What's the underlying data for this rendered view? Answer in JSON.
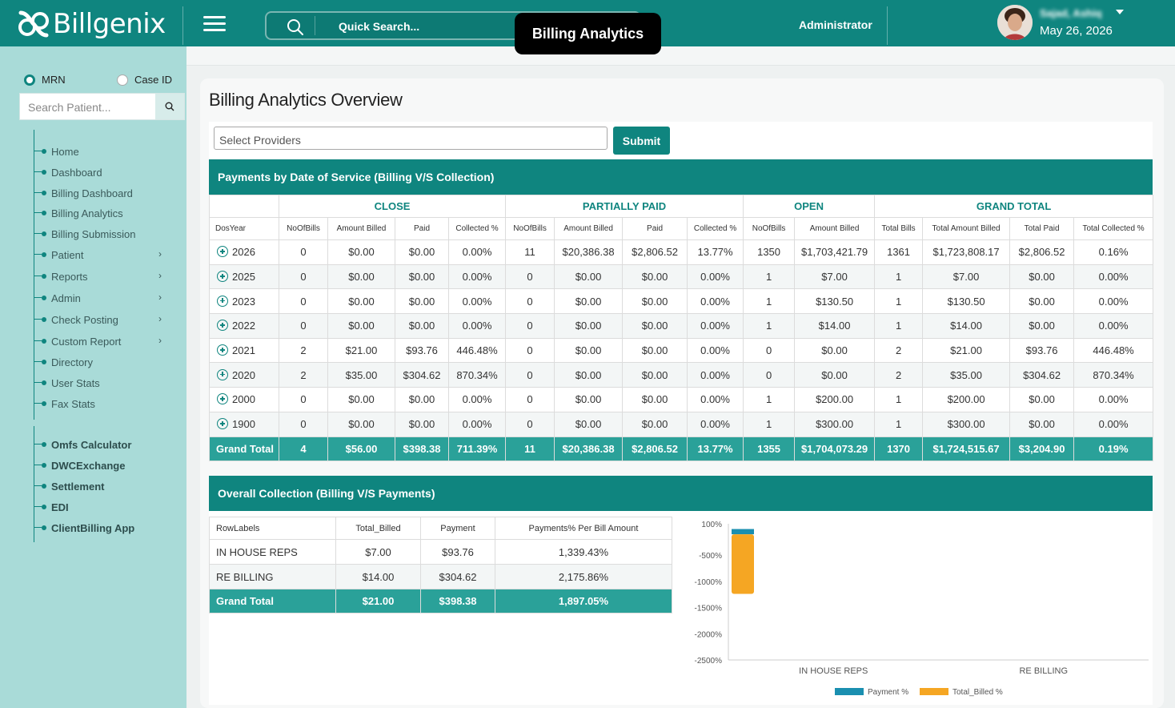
{
  "header": {
    "logo_text": "Billgenix",
    "search_placeholder": "Quick Search...",
    "tooltip": "Billing Analytics",
    "role": "Administrator",
    "username": "Sajad, Ashiq",
    "date": "May 26, 2026"
  },
  "sidebar": {
    "radio_mrn": "MRN",
    "radio_case": "Case ID",
    "search_placeholder": "Search Patient...",
    "items": [
      {
        "label": "Home"
      },
      {
        "label": "Dashboard"
      },
      {
        "label": "Billing Dashboard"
      },
      {
        "label": "Billing Analytics"
      },
      {
        "label": "Billing Submission"
      },
      {
        "label": "Patient"
      },
      {
        "label": "Reports"
      },
      {
        "label": "Admin"
      },
      {
        "label": "Check Posting"
      },
      {
        "label": "Custom Report"
      },
      {
        "label": "Directory"
      },
      {
        "label": "User Stats"
      },
      {
        "label": "Fax Stats"
      }
    ],
    "items2": [
      {
        "label": "Omfs Calculator"
      },
      {
        "label": "DWCExchange"
      },
      {
        "label": "Settlement"
      },
      {
        "label": "EDI"
      },
      {
        "label": "ClientBilling App"
      }
    ]
  },
  "main": {
    "title": "Billing Analytics Overview",
    "provider_placeholder": "Select Providers",
    "submit_label": "Submit",
    "section1_title": "Payments by Date of Service (Billing V/S Collection)",
    "section2_title": "Overall Collection (Billing V/S Payments)"
  },
  "payments_table": {
    "groups": [
      "CLOSE",
      "PARTIALLY PAID",
      "OPEN",
      "GRAND TOTAL"
    ],
    "columns": [
      "DosYear",
      "NoOfBills",
      "Amount Billed",
      "Paid",
      "Collected %",
      "NoOfBills",
      "Amount Billed",
      "Paid",
      "Collected %",
      "NoOfBills",
      "Amount Billed",
      "Total Bills",
      "Total Amount Billed",
      "Total Paid",
      "Total Collected %"
    ],
    "rows": [
      [
        "2026",
        "0",
        "$0.00",
        "$0.00",
        "0.00%",
        "11",
        "$20,386.38",
        "$2,806.52",
        "13.77%",
        "1350",
        "$1,703,421.79",
        "1361",
        "$1,723,808.17",
        "$2,806.52",
        "0.16%"
      ],
      [
        "2025",
        "0",
        "$0.00",
        "$0.00",
        "0.00%",
        "0",
        "$0.00",
        "$0.00",
        "0.00%",
        "1",
        "$7.00",
        "1",
        "$7.00",
        "$0.00",
        "0.00%"
      ],
      [
        "2023",
        "0",
        "$0.00",
        "$0.00",
        "0.00%",
        "0",
        "$0.00",
        "$0.00",
        "0.00%",
        "1",
        "$130.50",
        "1",
        "$130.50",
        "$0.00",
        "0.00%"
      ],
      [
        "2022",
        "0",
        "$0.00",
        "$0.00",
        "0.00%",
        "0",
        "$0.00",
        "$0.00",
        "0.00%",
        "1",
        "$14.00",
        "1",
        "$14.00",
        "$0.00",
        "0.00%"
      ],
      [
        "2021",
        "2",
        "$21.00",
        "$93.76",
        "446.48%",
        "0",
        "$0.00",
        "$0.00",
        "0.00%",
        "0",
        "$0.00",
        "2",
        "$21.00",
        "$93.76",
        "446.48%"
      ],
      [
        "2020",
        "2",
        "$35.00",
        "$304.62",
        "870.34%",
        "0",
        "$0.00",
        "$0.00",
        "0.00%",
        "0",
        "$0.00",
        "2",
        "$35.00",
        "$304.62",
        "870.34%"
      ],
      [
        "2000",
        "0",
        "$0.00",
        "$0.00",
        "0.00%",
        "0",
        "$0.00",
        "$0.00",
        "0.00%",
        "1",
        "$200.00",
        "1",
        "$200.00",
        "$0.00",
        "0.00%"
      ],
      [
        "1900",
        "0",
        "$0.00",
        "$0.00",
        "0.00%",
        "0",
        "$0.00",
        "$0.00",
        "0.00%",
        "1",
        "$300.00",
        "1",
        "$300.00",
        "$0.00",
        "0.00%"
      ]
    ],
    "grand_total": [
      "Grand Total",
      "4",
      "$56.00",
      "$398.38",
      "711.39%",
      "11",
      "$20,386.38",
      "$2,806.52",
      "13.77%",
      "1355",
      "$1,704,073.29",
      "1370",
      "$1,724,515.67",
      "$3,204.90",
      "0.19%"
    ]
  },
  "collection_table": {
    "columns": [
      "RowLabels",
      "Total_Billed",
      "Payment",
      "Payments% Per Bill Amount"
    ],
    "rows": [
      [
        "IN HOUSE REPS",
        "$7.00",
        "$93.76",
        "1,339.43%"
      ],
      [
        "RE BILLING",
        "$14.00",
        "$304.62",
        "2,175.86%"
      ]
    ],
    "grand_total": [
      "Grand Total",
      "$21.00",
      "$398.38",
      "1,897.05%"
    ]
  },
  "chart_data": {
    "type": "bar",
    "stacked": true,
    "categories": [
      "IN HOUSE REPS",
      "RE BILLING"
    ],
    "series": [
      {
        "name": "Payment %",
        "values": [
          -100,
          0
        ],
        "color": "#1a8fb0"
      },
      {
        "name": "Total_Billed %",
        "values": [
          -1139,
          0
        ],
        "color": "#f5a623"
      }
    ],
    "y_ticks": [
      "100%",
      "-500%",
      "-1000%",
      "-1500%",
      "-2000%",
      "-2500%"
    ],
    "y_tick_values": [
      100,
      -500,
      -1000,
      -1500,
      -2000,
      -2500
    ],
    "ylim": [
      -2500,
      100
    ],
    "legend": "bottom",
    "grid": false
  }
}
